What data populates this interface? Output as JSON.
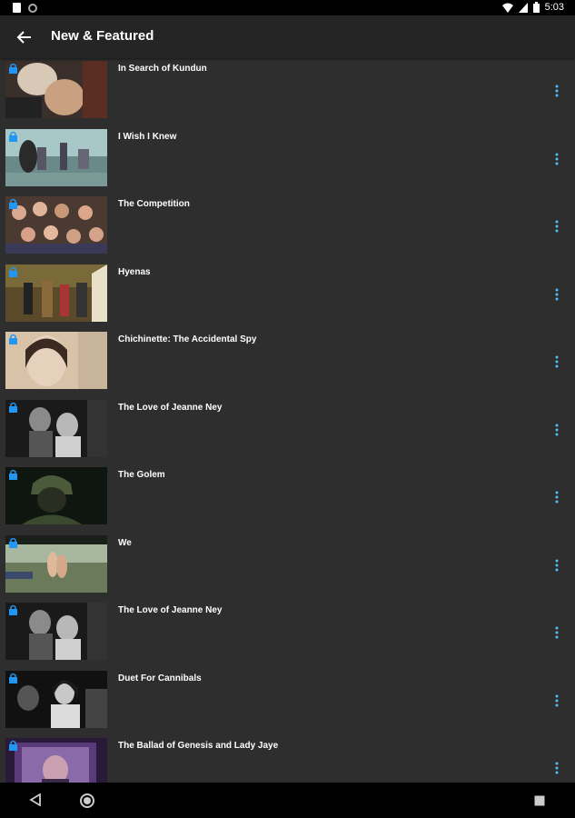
{
  "status_bar": {
    "time": "5:03",
    "icons": [
      "notification-icon",
      "sync-icon",
      "wifi-icon",
      "signal-icon",
      "battery-icon"
    ]
  },
  "app_bar": {
    "title": "New & Featured",
    "back_icon": "arrow-back-icon"
  },
  "colors": {
    "background": "#2e2e2e",
    "app_bar": "#252525",
    "accent": "#2196f3",
    "more_icon": "#4fc3f7"
  },
  "films": [
    {
      "title": "In Search of Kundun"
    },
    {
      "title": "I Wish I Knew"
    },
    {
      "title": "The Competition"
    },
    {
      "title": "Hyenas"
    },
    {
      "title": "Chichinette: The Accidental Spy"
    },
    {
      "title": "The Love of Jeanne Ney"
    },
    {
      "title": "The Golem"
    },
    {
      "title": "We"
    },
    {
      "title": "The Love of Jeanne Ney"
    },
    {
      "title": "Duet For Cannibals"
    },
    {
      "title": "The Ballad of Genesis and Lady Jaye"
    }
  ],
  "nav_bar": {
    "icons": [
      "nav-back-icon",
      "nav-home-icon",
      "nav-recents-icon"
    ]
  }
}
